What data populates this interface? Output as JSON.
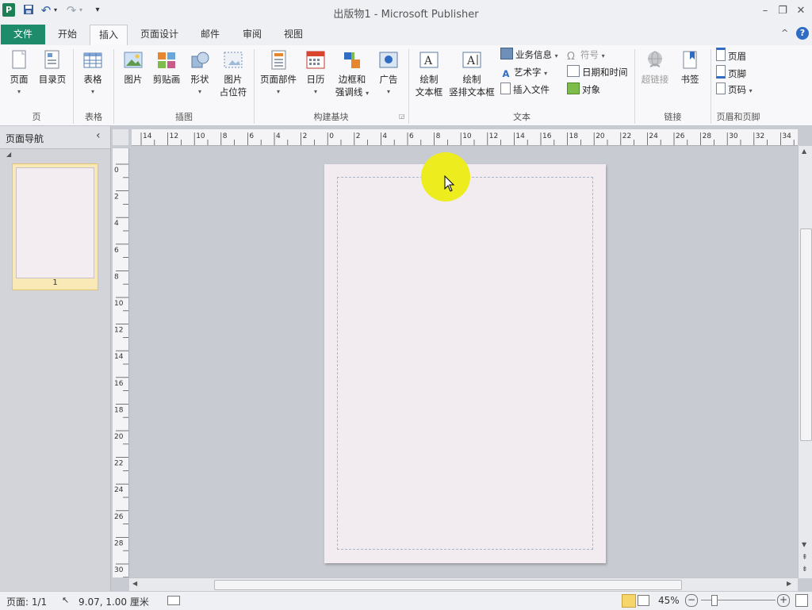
{
  "window": {
    "title": "出版物1 - Microsoft Publisher",
    "app_icon_letter": "P",
    "minimize_symbol": "–",
    "restore_symbol": "❐",
    "close_symbol": "✕",
    "collapse_ribbon_symbol": "^",
    "help_symbol": "?"
  },
  "quick_access": {
    "save_icon": "floppy-disk-icon",
    "undo_symbol": "↶",
    "redo_symbol": "↷",
    "customize_symbol": "▾"
  },
  "tabs": [
    {
      "label": "文件"
    },
    {
      "label": "开始"
    },
    {
      "label": "插入"
    },
    {
      "label": "页面设计"
    },
    {
      "label": "邮件"
    },
    {
      "label": "审阅"
    },
    {
      "label": "视图"
    }
  ],
  "active_tab": "插入",
  "ribbon": {
    "groups": {
      "pages": "页",
      "tables": "表格",
      "illustrations": "插图",
      "building_blocks": "构建基块",
      "text": "文本",
      "links": "链接",
      "header_footer": "页眉和页脚"
    },
    "buttons": {
      "page": "页面",
      "catalog_page": "目录页",
      "table": "表格",
      "picture": "图片",
      "clip_art": "剪贴画",
      "shapes": "形状",
      "picture_placeholder_1": "图片",
      "picture_placeholder_2": "占位符",
      "page_parts": "页面部件",
      "calendars": "日历",
      "borders_1": "边框和",
      "borders_2": "强调线",
      "ads": "广告",
      "draw_textbox_1": "绘制",
      "draw_textbox_2": "文本框",
      "draw_vertical_1": "绘制",
      "draw_vertical_2": "竖排文本框",
      "business_info": "业务信息",
      "wordart": "艺术字",
      "insert_file": "插入文件",
      "symbol": "符号",
      "date_time": "日期和时间",
      "object": "对象",
      "hyperlink": "超链接",
      "bookmark": "书签",
      "header": "页眉",
      "footer": "页脚",
      "page_number": "页码"
    },
    "dropdown_arrow": "▾",
    "symbol_glyph": "Ω"
  },
  "nav_pane": {
    "title": "页面导航",
    "collapse_symbol": "‹",
    "expand_symbol": "◢",
    "pages": [
      {
        "number": "1",
        "selected": true
      }
    ]
  },
  "rulers": {
    "horizontal_labels": [
      "14",
      "12",
      "10",
      "8",
      "6",
      "4",
      "2",
      "0",
      "2",
      "4",
      "6",
      "8",
      "10",
      "12",
      "14",
      "16",
      "18",
      "20",
      "22",
      "24",
      "26",
      "28",
      "30",
      "32",
      "34"
    ],
    "vertical_labels": [
      "0",
      "2",
      "4",
      "6",
      "8",
      "10",
      "12",
      "14",
      "16",
      "18",
      "20",
      "22",
      "24",
      "26",
      "28",
      "30"
    ]
  },
  "scrollbars": {
    "up_symbol": "▲",
    "down_symbol": "▼",
    "left_symbol": "◀",
    "right_symbol": "▶",
    "prev_page_symbol": "⇞",
    "next_page_symbol": "⇟"
  },
  "status_bar": {
    "page_info": "页面: 1/1",
    "position": "9.07, 1.00 厘米",
    "zoom": "45%",
    "zoom_out": "−",
    "zoom_in": "+"
  },
  "colors": {
    "file_tab": "#1e8c6a",
    "cursor_highlight": "#ecec1e",
    "page": "#f2ecf1"
  }
}
